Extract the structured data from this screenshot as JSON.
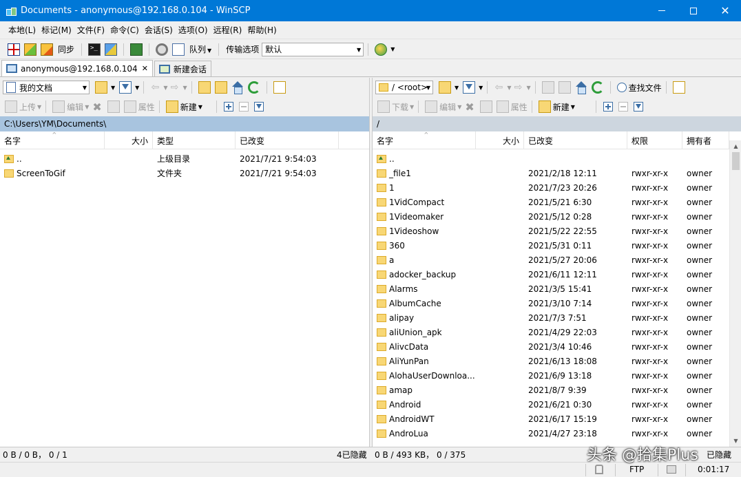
{
  "window": {
    "title": "Documents - anonymous@192.168.0.104 - WinSCP"
  },
  "menu": [
    "本地(L)",
    "标记(M)",
    "文件(F)",
    "命令(C)",
    "会话(S)",
    "选项(O)",
    "远程(R)",
    "帮助(H)"
  ],
  "toolbar": {
    "sync_label": "同步",
    "queue_label": "队列",
    "transfer_label": "传输选项",
    "transfer_value": "默认"
  },
  "tabs": {
    "session": "anonymous@192.168.0.104",
    "new_session": "新建会话"
  },
  "left_panel": {
    "location": "我的文档",
    "upload_label": "上传",
    "edit_label": "编辑",
    "props_label": "属性",
    "new_label": "新建",
    "path": "C:\\Users\\YM\\Documents\\",
    "columns": {
      "name": "名字",
      "size": "大小",
      "type": "类型",
      "changed": "已改变"
    },
    "rows": [
      {
        "name": "..",
        "size": "",
        "type": "上级目录",
        "changed": "2021/7/21   9:54:03",
        "icon": "parent-folder-icon"
      },
      {
        "name": "ScreenToGif",
        "size": "",
        "type": "文件夹",
        "changed": "2021/7/21   9:54:03",
        "icon": "folder-icon"
      }
    ]
  },
  "right_panel": {
    "location": "/ <root>",
    "find_label": "查找文件",
    "download_label": "下载",
    "edit_label": "编辑",
    "props_label": "属性",
    "new_label": "新建",
    "path": "/",
    "columns": {
      "name": "名字",
      "size": "大小",
      "changed": "已改变",
      "rights": "权限",
      "owner": "拥有者"
    },
    "rows": [
      {
        "name": "..",
        "changed": "",
        "rights": "",
        "owner": "",
        "icon": "parent-folder-icon"
      },
      {
        "name": "_file1",
        "changed": "2021/2/18 12:11",
        "rights": "rwxr-xr-x",
        "owner": "owner",
        "icon": "folder-icon"
      },
      {
        "name": "1",
        "changed": "2021/7/23 20:26",
        "rights": "rwxr-xr-x",
        "owner": "owner",
        "icon": "folder-icon"
      },
      {
        "name": "1VidCompact",
        "changed": "2021/5/21 6:30",
        "rights": "rwxr-xr-x",
        "owner": "owner",
        "icon": "folder-icon"
      },
      {
        "name": "1Videomaker",
        "changed": "2021/5/12 0:28",
        "rights": "rwxr-xr-x",
        "owner": "owner",
        "icon": "folder-icon"
      },
      {
        "name": "1Videoshow",
        "changed": "2021/5/22 22:55",
        "rights": "rwxr-xr-x",
        "owner": "owner",
        "icon": "folder-icon"
      },
      {
        "name": "360",
        "changed": "2021/5/31 0:11",
        "rights": "rwxr-xr-x",
        "owner": "owner",
        "icon": "folder-icon"
      },
      {
        "name": "a",
        "changed": "2021/5/27 20:06",
        "rights": "rwxr-xr-x",
        "owner": "owner",
        "icon": "folder-icon"
      },
      {
        "name": "adocker_backup",
        "changed": "2021/6/11 12:11",
        "rights": "rwxr-xr-x",
        "owner": "owner",
        "icon": "folder-icon"
      },
      {
        "name": "Alarms",
        "changed": "2021/3/5 15:41",
        "rights": "rwxr-xr-x",
        "owner": "owner",
        "icon": "folder-icon"
      },
      {
        "name": "AlbumCache",
        "changed": "2021/3/10 7:14",
        "rights": "rwxr-xr-x",
        "owner": "owner",
        "icon": "folder-icon"
      },
      {
        "name": "alipay",
        "changed": "2021/7/3 7:51",
        "rights": "rwxr-xr-x",
        "owner": "owner",
        "icon": "folder-icon"
      },
      {
        "name": "aliUnion_apk",
        "changed": "2021/4/29 22:03",
        "rights": "rwxr-xr-x",
        "owner": "owner",
        "icon": "folder-icon"
      },
      {
        "name": "AlivcData",
        "changed": "2021/3/4 10:46",
        "rights": "rwxr-xr-x",
        "owner": "owner",
        "icon": "folder-icon"
      },
      {
        "name": "AliYunPan",
        "changed": "2021/6/13 18:08",
        "rights": "rwxr-xr-x",
        "owner": "owner",
        "icon": "folder-icon"
      },
      {
        "name": "AlohaUserDownloa...",
        "changed": "2021/6/9 13:18",
        "rights": "rwxr-xr-x",
        "owner": "owner",
        "icon": "folder-icon"
      },
      {
        "name": "amap",
        "changed": "2021/8/7 9:39",
        "rights": "rwxr-xr-x",
        "owner": "owner",
        "icon": "folder-icon"
      },
      {
        "name": "Android",
        "changed": "2021/6/21 0:30",
        "rights": "rwxr-xr-x",
        "owner": "owner",
        "icon": "folder-icon"
      },
      {
        "name": "AndroidWT",
        "changed": "2021/6/17 15:19",
        "rights": "rwxr-xr-x",
        "owner": "owner",
        "icon": "folder-icon"
      },
      {
        "name": "AndroLua",
        "changed": "2021/4/27 23:18",
        "rights": "rwxr-xr-x",
        "owner": "owner",
        "icon": "folder-icon"
      }
    ]
  },
  "status": {
    "left": "0 B / 0 B， 0 / 1",
    "left_hidden": "4已隐藏",
    "right": "0 B / 493 KB， 0 / 375",
    "right_hidden": "已隐藏",
    "protocol": "FTP",
    "elapsed": "0:01:17"
  },
  "watermark": "头条 @拾集Plus"
}
